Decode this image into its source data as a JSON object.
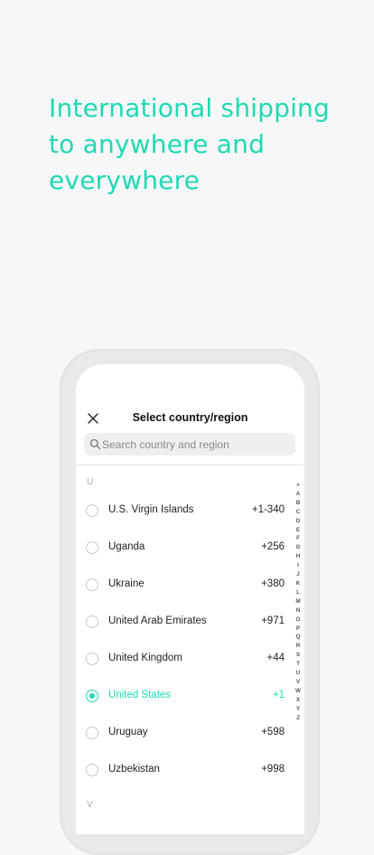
{
  "headline": {
    "lines": [
      "International shipping",
      "to anywhere and",
      "everywhere"
    ]
  },
  "screen": {
    "title": "Select country/region",
    "close_icon": "close-icon",
    "search": {
      "placeholder": "Search country and region",
      "icon": "search-icon"
    },
    "sections": [
      {
        "letter": "U",
        "countries": [
          {
            "name": "U.S. Virgin Islands",
            "code": "+1-340",
            "selected": false
          },
          {
            "name": "Uganda",
            "code": "+256",
            "selected": false
          },
          {
            "name": "Ukraine",
            "code": "+380",
            "selected": false
          },
          {
            "name": "United Arab Emirates",
            "code": "+971",
            "selected": false
          },
          {
            "name": "United Kingdom",
            "code": "+44",
            "selected": false
          },
          {
            "name": "United States",
            "code": "+1",
            "selected": true
          },
          {
            "name": "Uruguay",
            "code": "+598",
            "selected": false
          },
          {
            "name": "Uzbekistan",
            "code": "+998",
            "selected": false
          }
        ]
      },
      {
        "letter": "V",
        "countries": []
      }
    ],
    "index": [
      "⌕",
      "A",
      "B",
      "C",
      "D",
      "E",
      "F",
      "G",
      "H",
      "I",
      "J",
      "K",
      "L",
      "M",
      "N",
      "O",
      "P",
      "Q",
      "R",
      "S",
      "T",
      "U",
      "V",
      "W",
      "X",
      "Y",
      "Z"
    ]
  },
  "colors": {
    "accent": "#1fd9b4",
    "background": "#f7f7f7"
  }
}
